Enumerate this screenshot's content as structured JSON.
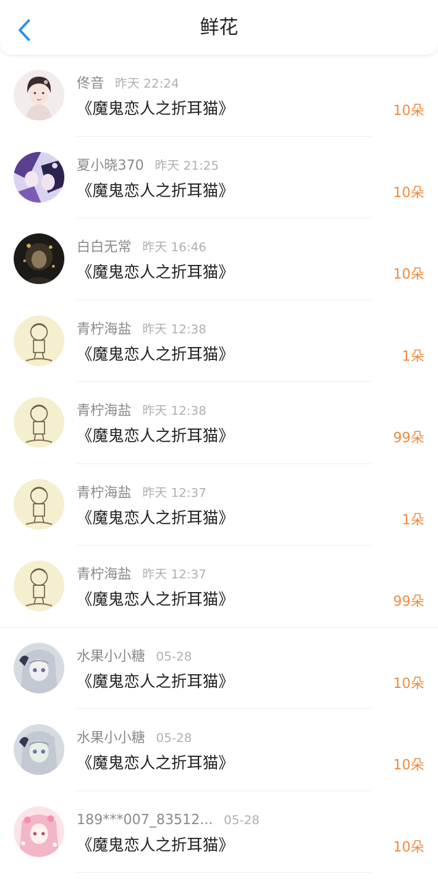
{
  "header": {
    "title": "鲜花",
    "back_icon": "chevron-left-icon",
    "accent_color": "#2e8fe8"
  },
  "items": [
    {
      "name": "佟音",
      "time": "昨天 22:24",
      "book": "《魔鬼恋人之折耳猫》",
      "count": "10朵",
      "avatar": "avatar-girl-portrait"
    },
    {
      "name": "夏小晓370",
      "time": "昨天 21:25",
      "book": "《魔鬼恋人之折耳猫》",
      "count": "10朵",
      "avatar": "avatar-anime-purple"
    },
    {
      "name": "白白无常",
      "time": "昨天 16:46",
      "book": "《魔鬼恋人之折耳猫》",
      "count": "10朵",
      "avatar": "avatar-dark-gold"
    },
    {
      "name": "青柠海盐",
      "time": "昨天 12:38",
      "book": "《魔鬼恋人之折耳猫》",
      "count": "1朵",
      "avatar": "avatar-sketch-chibi"
    },
    {
      "name": "青柠海盐",
      "time": "昨天 12:38",
      "book": "《魔鬼恋人之折耳猫》",
      "count": "99朵",
      "avatar": "avatar-sketch-chibi"
    },
    {
      "name": "青柠海盐",
      "time": "昨天 12:37",
      "book": "《魔鬼恋人之折耳猫》",
      "count": "1朵",
      "avatar": "avatar-sketch-chibi"
    },
    {
      "name": "青柠海盐",
      "time": "昨天 12:37",
      "book": "《魔鬼恋人之折耳猫》",
      "count": "99朵",
      "avatar": "avatar-sketch-chibi"
    },
    {
      "name": "水果小小糖",
      "time": "05-28",
      "book": "《魔鬼恋人之折耳猫》",
      "count": "10朵",
      "avatar": "avatar-anime-silver"
    },
    {
      "name": "水果小小糖",
      "time": "05-28",
      "book": "《魔鬼恋人之折耳猫》",
      "count": "10朵",
      "avatar": "avatar-anime-silver"
    },
    {
      "name": "189***007_83512...",
      "time": "05-28",
      "book": "《魔鬼恋人之折耳猫》",
      "count": "10朵",
      "avatar": "avatar-anime-pink"
    }
  ],
  "colors": {
    "count": "#f08a3c",
    "name": "#8a8a8a",
    "time": "#b0b0b0",
    "book": "#222222"
  }
}
